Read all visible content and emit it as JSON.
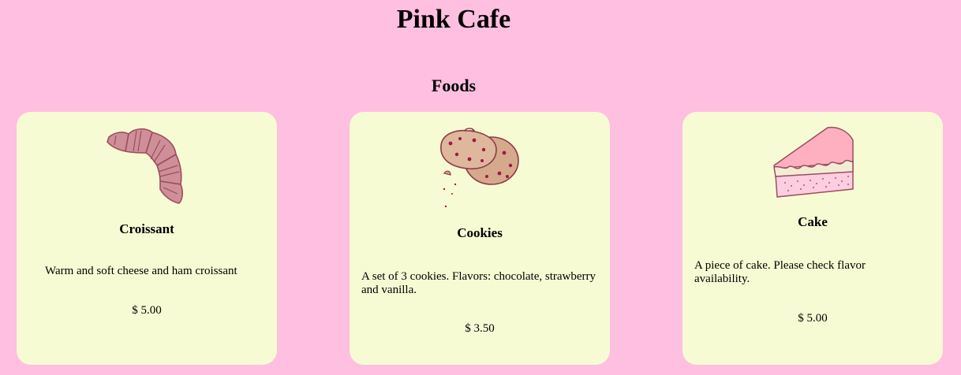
{
  "header": {
    "title": "Pink Cafe"
  },
  "section": {
    "title": "Foods"
  },
  "items": [
    {
      "name": "Croissant",
      "icon": "croissant-icon",
      "description": "Warm and soft cheese and ham croissant",
      "price": "$ 5.00"
    },
    {
      "name": "Cookies",
      "icon": "cookies-icon",
      "description": "A set of 3 cookies. Flavors: chocolate, strawberry and vanilla.",
      "price": "$ 3.50"
    },
    {
      "name": "Cake",
      "icon": "cake-icon",
      "description": "A piece of cake. Please check flavor availability.",
      "price": "$ 5.00"
    }
  ],
  "colors": {
    "page_background": "#ffbfe0",
    "card_background": "#f7fbd4",
    "croissant": "#cf8f98",
    "cookie": "#dfb79c",
    "cookie_chip": "#9b1b4a",
    "cake_frosting": "#ffb0c0",
    "cake_body": "#fdcde0"
  }
}
